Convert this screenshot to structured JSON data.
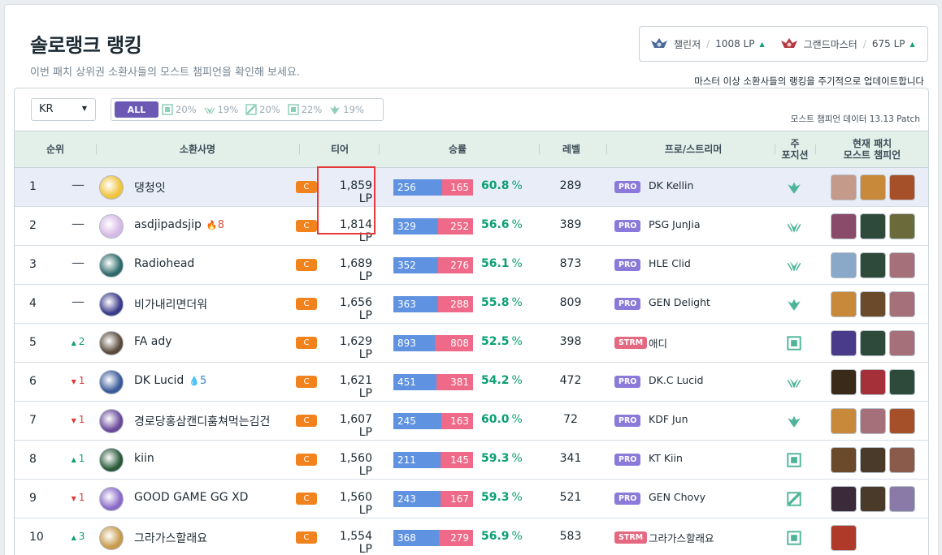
{
  "header": {
    "title": "솔로랭크 랭킹",
    "subtitle": "이번 패치 상위권 소환사들의 모스트 챔피언을 확인해 보세요.",
    "update_note": "마스터 이상 소환사들의 랭킹을 주기적으로 업데이트합니다"
  },
  "cutoffs": [
    {
      "name": "챌린저",
      "lp": "1008 LP",
      "color": "#4b6a9a"
    },
    {
      "name": "그랜드마스터",
      "lp": "675 LP",
      "color": "#b43a42"
    }
  ],
  "filters": {
    "region": "KR",
    "all_label": "ALL",
    "positions": [
      {
        "icon": "top-icon",
        "pct": "20%"
      },
      {
        "icon": "jungle-icon",
        "pct": "19%"
      },
      {
        "icon": "mid-icon",
        "pct": "20%"
      },
      {
        "icon": "bottom-icon",
        "pct": "22%"
      },
      {
        "icon": "support-icon",
        "pct": "19%"
      }
    ],
    "patch_note": "모스트 챔피언 데이터 13.13 Patch"
  },
  "columns": {
    "rank": "순위",
    "summoner": "소환사명",
    "tier": "티어",
    "winloss": "승률",
    "level": "레벨",
    "pro": "프로/스트리머",
    "position_line1": "주",
    "position_line2": "포지션",
    "champs_line1": "현재 패치",
    "champs_line2": "모스트 챔피언"
  },
  "rows": [
    {
      "rank": "1",
      "change": "—",
      "dir": "none",
      "name": "댕청잇",
      "streak": "",
      "streak_type": "",
      "tier": "C",
      "lp": "1,859 LP",
      "wins": "256",
      "losses": "165",
      "wr": "60.8",
      "level": "289",
      "tag": "PRO",
      "pro": "DK Kellin",
      "pos": "support-icon",
      "avatar": "#f0c33b",
      "champs": [
        "#c49a8a",
        "#c8893a",
        "#a6502a"
      ]
    },
    {
      "rank": "2",
      "change": "—",
      "dir": "none",
      "name": "asdjipadsjip",
      "streak": "8",
      "streak_type": "hot",
      "tier": "C",
      "lp": "1,814 LP",
      "wins": "329",
      "losses": "252",
      "wr": "56.6",
      "level": "389",
      "tag": "PRO",
      "pro": "PSG JunJia",
      "pos": "jungle-icon",
      "avatar": "#d7b9e6",
      "champs": [
        "#8a4a6a",
        "#2e4a3a",
        "#6a6a3a"
      ]
    },
    {
      "rank": "3",
      "change": "—",
      "dir": "none",
      "name": "Radiohead",
      "streak": "",
      "streak_type": "",
      "tier": "C",
      "lp": "1,689 LP",
      "wins": "352",
      "losses": "276",
      "wr": "56.1",
      "level": "873",
      "tag": "PRO",
      "pro": "HLE Clid",
      "pos": "jungle-icon",
      "avatar": "#2e6a6a",
      "champs": [
        "#8aa8c8",
        "#2e4a3a",
        "#a5707a"
      ]
    },
    {
      "rank": "4",
      "change": "—",
      "dir": "none",
      "name": "비가내리면더워",
      "streak": "",
      "streak_type": "",
      "tier": "C",
      "lp": "1,656 LP",
      "wins": "363",
      "losses": "288",
      "wr": "55.8",
      "level": "809",
      "tag": "PRO",
      "pro": "GEN Delight",
      "pos": "support-icon",
      "avatar": "#3a3a8a",
      "champs": [
        "#c8893a",
        "#6a4a2a",
        "#a5707a"
      ]
    },
    {
      "rank": "5",
      "change": "2",
      "dir": "up",
      "name": "FA ady",
      "streak": "",
      "streak_type": "",
      "tier": "C",
      "lp": "1,629 LP",
      "wins": "893",
      "losses": "808",
      "wr": "52.5",
      "level": "398",
      "tag": "STRM",
      "pro": "애디",
      "pos": "bottom-icon",
      "avatar": "#5a4a3a",
      "champs": [
        "#4a3a8a",
        "#2e4a3a",
        "#a5707a"
      ]
    },
    {
      "rank": "6",
      "change": "1",
      "dir": "down",
      "name": "DK Lucid",
      "streak": "5",
      "streak_type": "cold",
      "tier": "C",
      "lp": "1,621 LP",
      "wins": "451",
      "losses": "381",
      "wr": "54.2",
      "level": "472",
      "tag": "PRO",
      "pro": "DK.C Lucid",
      "pos": "jungle-icon",
      "avatar": "#3a5a9a",
      "champs": [
        "#3a2a1a",
        "#a5303a",
        "#2e4a3a"
      ]
    },
    {
      "rank": "7",
      "change": "1",
      "dir": "down",
      "name": "경로당홍삼캔디훔쳐먹는김건",
      "streak": "",
      "streak_type": "",
      "tier": "C",
      "lp": "1,607 LP",
      "wins": "245",
      "losses": "163",
      "wr": "60.0",
      "level": "72",
      "tag": "PRO",
      "pro": "KDF Jun",
      "pos": "support-icon",
      "avatar": "#6a4a9a",
      "champs": [
        "#c8893a",
        "#a5707a",
        "#a6502a"
      ]
    },
    {
      "rank": "8",
      "change": "1",
      "dir": "up",
      "name": "kiin",
      "streak": "",
      "streak_type": "",
      "tier": "C",
      "lp": "1,560 LP",
      "wins": "211",
      "losses": "145",
      "wr": "59.3",
      "level": "341",
      "tag": "PRO",
      "pro": "KT Kiin",
      "pos": "top-icon",
      "avatar": "#2a5a3a",
      "champs": [
        "#6a4a2a",
        "#4a3a2a",
        "#8a5a4a"
      ]
    },
    {
      "rank": "9",
      "change": "1",
      "dir": "down",
      "name": "GOOD GAME GG XD",
      "streak": "",
      "streak_type": "",
      "tier": "C",
      "lp": "1,560 LP",
      "wins": "243",
      "losses": "167",
      "wr": "59.3",
      "level": "521",
      "tag": "PRO",
      "pro": "GEN Chovy",
      "pos": "mid-icon",
      "avatar": "#8a6ac8",
      "champs": [
        "#3a2a3a",
        "#4a3a2a",
        "#8a7aa8"
      ]
    },
    {
      "rank": "10",
      "change": "3",
      "dir": "up",
      "name": "그라가스할래요",
      "streak": "",
      "streak_type": "",
      "tier": "C",
      "lp": "1,554 LP",
      "wins": "368",
      "losses": "279",
      "wr": "56.9",
      "level": "583",
      "tag": "STRM",
      "pro": "그라가스할래요",
      "pos": "top-icon",
      "avatar": "#c89a4a",
      "champs": [
        "#b03a2a"
      ]
    }
  ],
  "colors": {
    "accent": "#6b59b3",
    "win": "#5f92e0",
    "loss": "#ee6a88",
    "rate": "#0c9f74",
    "challenger_badge": "#f2821b"
  }
}
